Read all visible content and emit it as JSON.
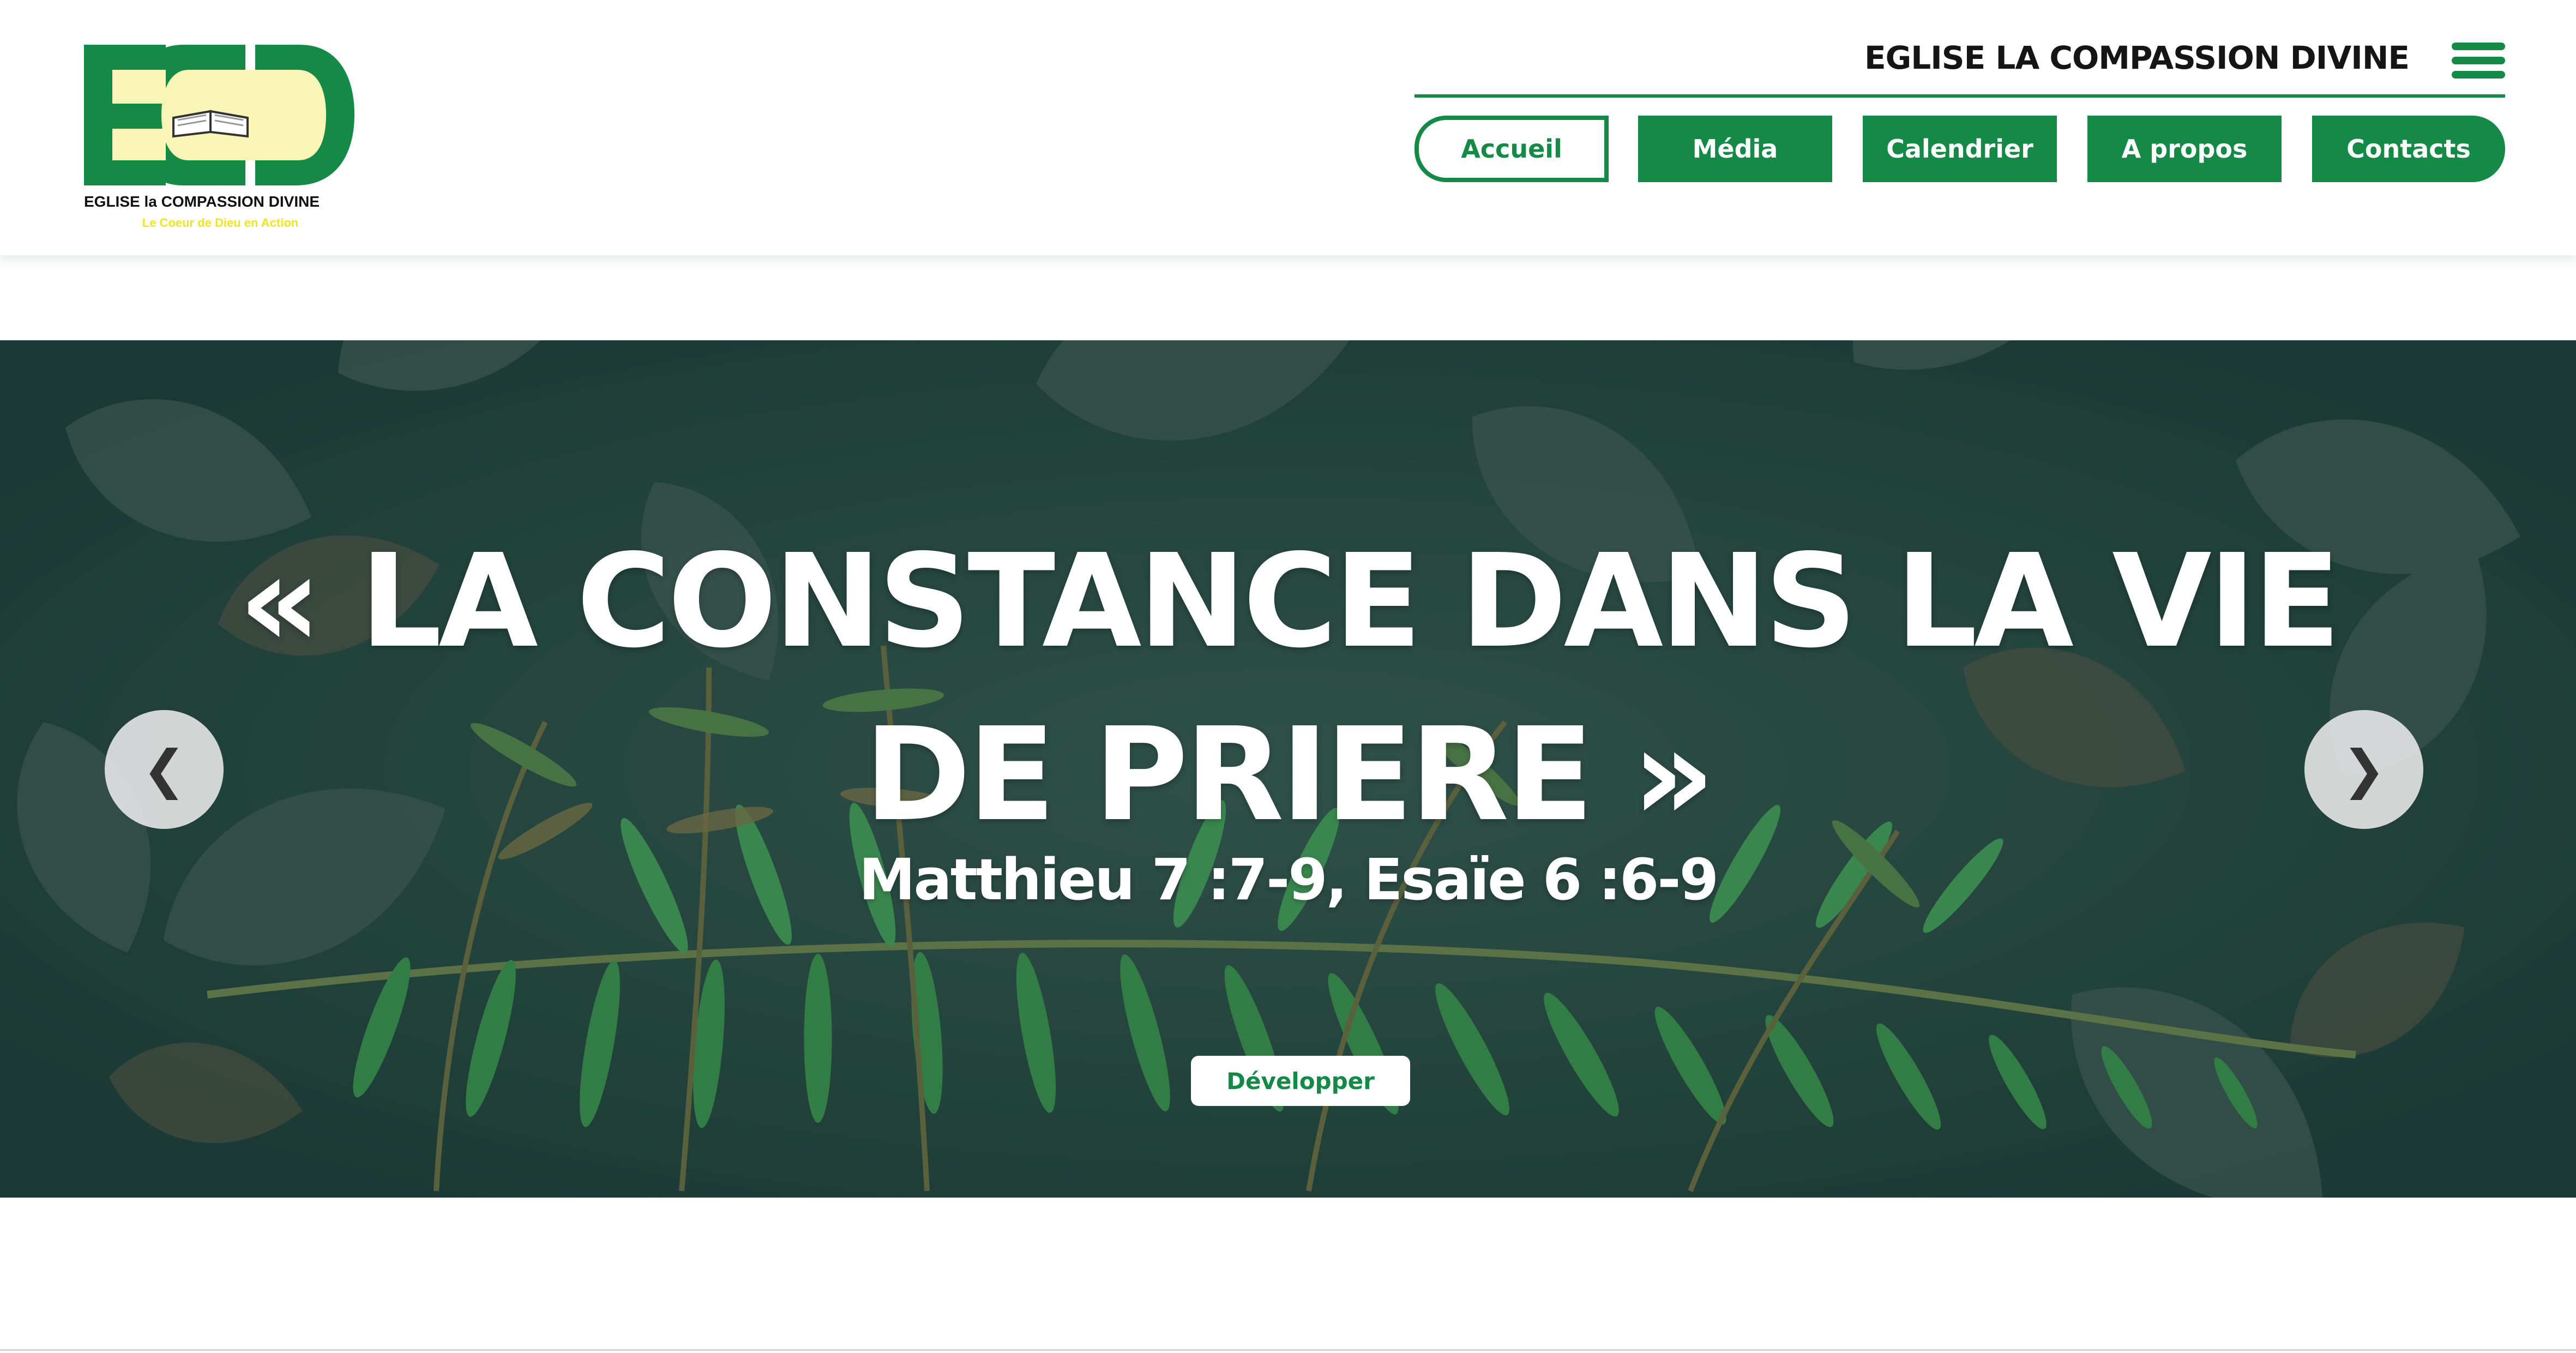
{
  "logo": {
    "monogram": "ECD",
    "name": "EGLISE la COMPASSION DIVINE",
    "tagline": "Le Coeur de Dieu en Action",
    "colors": {
      "green": "#148a46",
      "cream": "#f8f5b7",
      "tagline_yellow": "#f2e51c"
    }
  },
  "header": {
    "church_name": "EGLISE LA COMPASSION DIVINE",
    "menu_icon": "hamburger-icon"
  },
  "nav": {
    "items": [
      {
        "label": "Accueil",
        "active": true
      },
      {
        "label": "Média",
        "active": false
      },
      {
        "label": "Calendrier",
        "active": false
      },
      {
        "label": "A propos",
        "active": false
      },
      {
        "label": "Contacts",
        "active": false
      }
    ]
  },
  "hero": {
    "title_line1": "« LA CONSTANCE DANS LA VIE",
    "title_line2": "DE PRIERE »",
    "subtitle": "Matthieu 7 :7-9, Esaïe 6 :6-9",
    "button_label": "Développer",
    "prev_arrow": "❮",
    "next_arrow": "❯",
    "background": "fern-and-leaves-photo"
  },
  "colors": {
    "brand_green": "#148a46",
    "hero_overlay": "#2b4942"
  }
}
